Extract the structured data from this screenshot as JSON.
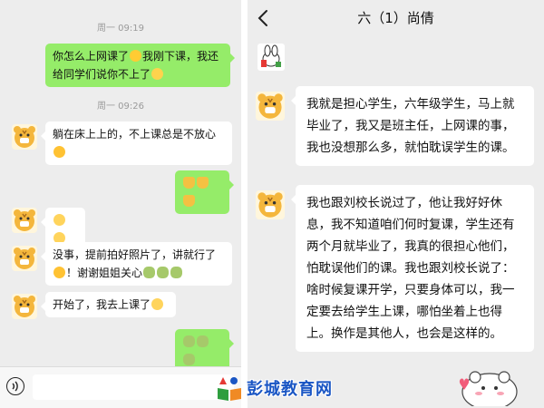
{
  "left_chat": {
    "timestamps": [
      "周一 09:19",
      "周一 09:26"
    ],
    "messages": {
      "m1": "你怎么上网课了",
      "m1b": "我刚下课，我还给同学们说你不上了",
      "m2": "躺在床上上的，不上课总是不放心",
      "m5": "没事，提前拍好照片了，讲就行了",
      "m5b": "！谢谢姐姐关心",
      "m6": "开始了，我去上课了"
    }
  },
  "right_chat": {
    "title": "六（1）尚倩",
    "messages": {
      "r1": "我就是担心学生，六年级学生，马上就毕业了，我又是班主任，上网课的事，我也没想那么多，就怕耽误学生的课。",
      "r2": "我也跟刘校长说过了，他让我好好休息，我不知道咱们何时复课，学生还有两个月就毕业了，我真的很担心他们，怕耽误他们的课。我也跟刘校长说了：啥时候复课开学，只要身体可以，我一定要去给学生上课，哪怕坐着上也得上。换作是其他人，也会是这样的。"
    }
  },
  "watermark": {
    "text": "彭城教育网"
  },
  "icons": [
    "tiger-avatar-icon",
    "voice-icon",
    "back-arrow-icon",
    "bear-sticker-icon",
    "watermark-logo-icon"
  ],
  "colors": {
    "outgoing_bubble": "#95ec69",
    "incoming_bubble": "#ffffff",
    "chat_bg": "#ededed",
    "watermark": "#1a56c4"
  }
}
